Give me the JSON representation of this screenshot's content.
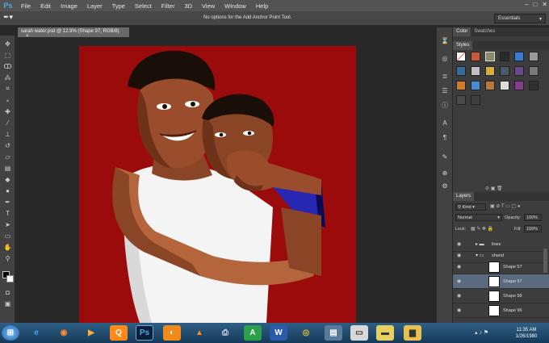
{
  "app": {
    "logo": "Ps"
  },
  "menu": [
    "File",
    "Edit",
    "Image",
    "Layer",
    "Type",
    "Select",
    "Filter",
    "3D",
    "View",
    "Window",
    "Help"
  ],
  "window_controls": {
    "minimize": "–",
    "maximize": "□",
    "close": "✕"
  },
  "options_bar": {
    "tool_icon": "add-anchor-pen-icon",
    "message": "No options for the Add Anchor Point Tool.",
    "workspace": "Essentials"
  },
  "document": {
    "tab_title": "sarah water.psd @ 12.9% (Shape 97, RGB/8)",
    "close": "×"
  },
  "colors": {
    "canvas_bg": "#9b0b0b",
    "panel_bg": "#3c3c3c",
    "selected_layer": "#5a6b80",
    "sleeve_blue": "#2727b3"
  },
  "color_panel": {
    "tabs": [
      "Color",
      "Swatches"
    ]
  },
  "styles_panel": {
    "title": "Styles"
  },
  "layers_panel": {
    "title": "Layers",
    "filter": "Kind",
    "blend_mode": "Normal",
    "opacity_label": "Opacity:",
    "opacity_value": "100%",
    "lock_label": "Lock:",
    "fill_label": "Fill:",
    "fill_value": "100%",
    "layers": [
      {
        "name": "lines",
        "type": "group",
        "selected": false
      },
      {
        "name": "shand",
        "type": "group-open",
        "selected": false
      },
      {
        "name": "Shape 57",
        "type": "shape",
        "selected": false
      },
      {
        "name": "Shape 97",
        "type": "shape",
        "selected": true
      },
      {
        "name": "Shape 98",
        "type": "shape",
        "selected": false
      },
      {
        "name": "Shape 96",
        "type": "shape",
        "selected": false
      }
    ]
  },
  "taskbar": {
    "start": "start-orb-icon",
    "apps": [
      "internet-explorer-icon",
      "firefox-icon",
      "media-player-icon",
      "q-app-icon",
      "photoshop-icon",
      "illustrator-icon",
      "vlc-icon",
      "printer-icon",
      "a-app-icon",
      "word-icon",
      "chrome-icon",
      "network-icon",
      "document-icon",
      "notes-icon",
      "folder-icon"
    ],
    "ps_label": "Ps",
    "q_label": "Q",
    "a_label": "A",
    "w_label": "W",
    "time": "11:35 AM",
    "date": "1/26/1980"
  }
}
